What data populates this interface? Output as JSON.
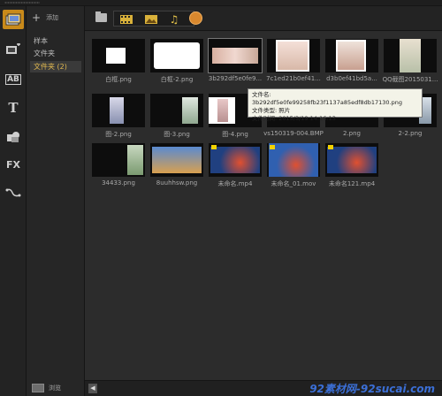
{
  "nav": {
    "add_label": "添加",
    "items": [
      {
        "label": "样本"
      },
      {
        "label": "文件夹"
      },
      {
        "label": "文件夹 (2)"
      }
    ],
    "browse_label": "浏览"
  },
  "rail": {
    "buttons": [
      {
        "icon": "media-library-icon",
        "active": true
      },
      {
        "icon": "instant-project-icon"
      },
      {
        "icon": "transition-icon",
        "text": "AB"
      },
      {
        "icon": "title-icon",
        "text": "T"
      },
      {
        "icon": "graphic-icon"
      },
      {
        "icon": "filter-icon",
        "text": "FX"
      },
      {
        "icon": "path-icon"
      }
    ]
  },
  "toolbar": {
    "buttons": [
      "folder-icon",
      "video-filter-icon",
      "photo-filter-icon",
      "audio-filter-icon",
      "sort-clock-icon"
    ]
  },
  "media": [
    {
      "name": "白框.png"
    },
    {
      "name": "白框-2.png"
    },
    {
      "name": "3b292df5e0fe9..."
    },
    {
      "name": "7c1ed21b0ef41..."
    },
    {
      "name": "d3b0ef41bd5a..."
    },
    {
      "name": "QQ截图2015031..."
    },
    {
      "name": "图-2.png"
    },
    {
      "name": "图-3.png"
    },
    {
      "name": "图-4.png"
    },
    {
      "name": "vs150319-004.BMP"
    },
    {
      "name": "2.png"
    },
    {
      "name": "2-2.png"
    },
    {
      "name": "34433.png"
    },
    {
      "name": "8uuhhsw.png"
    },
    {
      "name": "未命名.mp4"
    },
    {
      "name": "未命名_01.mov"
    },
    {
      "name": "未命名121.mp4"
    }
  ],
  "tooltip": {
    "line1": "文件名: 3b292df5e0fe99258fb23f1137a85edf8db17130.png",
    "line2": "文件类型: 照片",
    "line3": "文件时间: 2015/3/19 14:16:13"
  },
  "watermark": "92素材网-92sucai.com",
  "colors": {
    "accent": "#c98a1a",
    "background": "#2b2b2b"
  }
}
